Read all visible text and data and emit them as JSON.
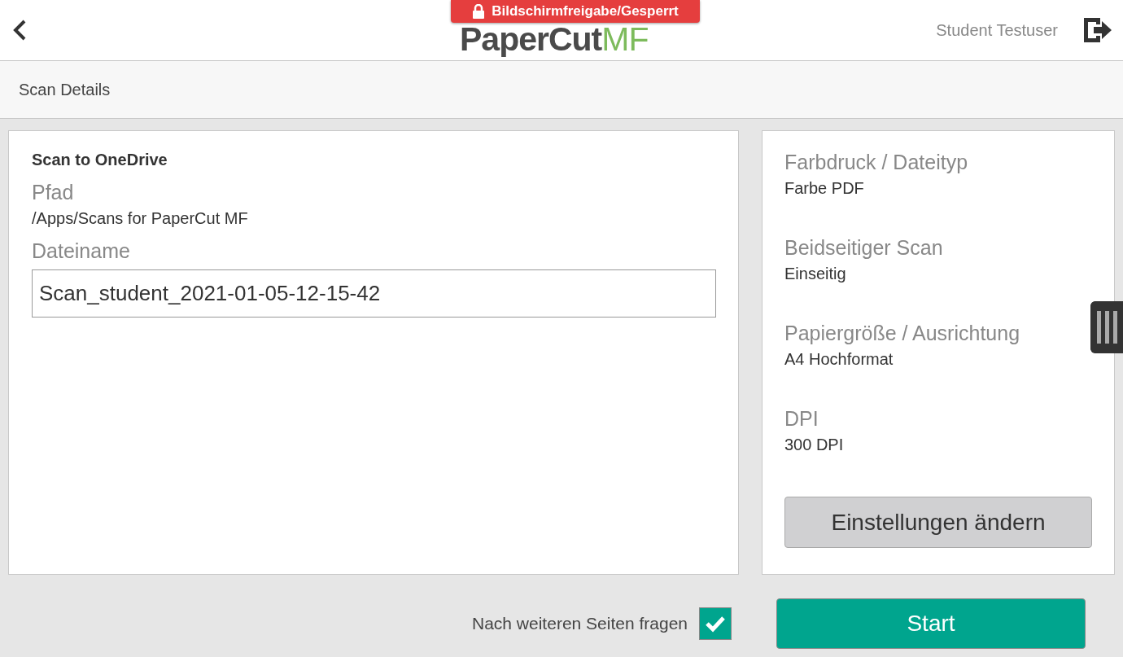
{
  "header": {
    "logo": {
      "name": "PaperCut",
      "suffix": "MF"
    },
    "lock_badge": "Bildschirmfreigabe/Gesperrt",
    "user": "Student Testuser"
  },
  "subheader": {
    "title": "Scan Details"
  },
  "destination": {
    "title": "Scan to OneDrive",
    "path_label": "Pfad",
    "path": "/Apps/Scans for PaperCut MF",
    "filename_label": "Dateiname",
    "filename": "Scan_student_2021-01-05-12-15-42"
  },
  "settings": [
    {
      "label": "Farbdruck / Dateityp",
      "value": "Farbe PDF"
    },
    {
      "label": "Beidseitiger Scan",
      "value": "Einseitig"
    },
    {
      "label": "Papiergröße / Ausrichtung",
      "value": "A4 Hochformat"
    },
    {
      "label": "DPI",
      "value": "300 DPI"
    }
  ],
  "change_button": "Einstellungen ändern",
  "ask_more_pages": {
    "label": "Nach weiteren Seiten fragen",
    "checked": true
  },
  "start_button": "Start"
}
